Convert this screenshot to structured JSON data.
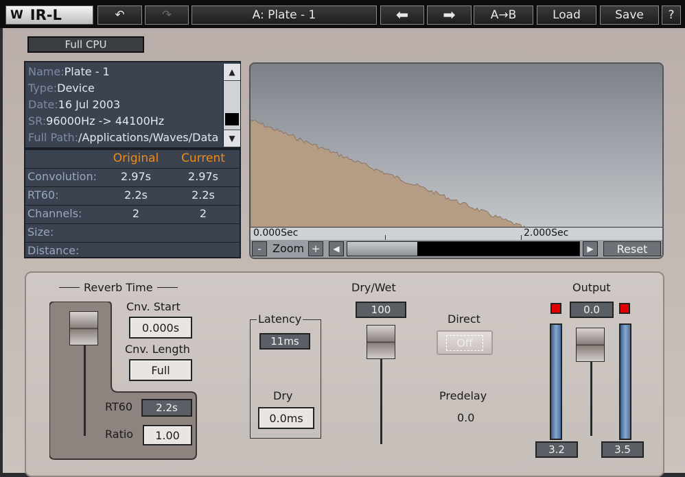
{
  "toolbar": {
    "logo": "IR-L",
    "preset": "A: Plate - 1",
    "ab_label": "A→B",
    "load_label": "Load",
    "save_label": "Save",
    "help_label": "?"
  },
  "cpu_mode": "Full CPU",
  "info": {
    "name_key": "Name:",
    "name": "Plate - 1",
    "type_key": "Type:",
    "type": "Device",
    "date_key": "Date:",
    "date": "16 Jul 2003",
    "sr_key": "SR:",
    "sr": "96000Hz -> 44100Hz",
    "path_key": "Full Path:",
    "path": "/Applications/Waves/Data"
  },
  "params_table": {
    "headers": [
      "Original",
      "Current"
    ],
    "rows": [
      {
        "label": "Convolution:",
        "original": "2.97s",
        "current": "2.97s"
      },
      {
        "label": "RT60:",
        "original": "2.2s",
        "current": "2.2s"
      },
      {
        "label": "Channels:",
        "original": "2",
        "current": "2"
      },
      {
        "label": "Size:",
        "original": "",
        "current": ""
      },
      {
        "label": "Distance:",
        "original": "",
        "current": ""
      }
    ]
  },
  "ir_display": {
    "time_start": "0.000Sec",
    "time_mark": "2.000Sec",
    "zoom_minus": "-",
    "zoom_label": "Zoom",
    "zoom_plus": "+",
    "reset_label": "Reset"
  },
  "reverb_time": {
    "title": "Reverb Time",
    "cnv_start_label": "Cnv. Start",
    "cnv_start": "0.000s",
    "cnv_length_label": "Cnv. Length",
    "cnv_length": "Full",
    "rt60_label": "RT60",
    "rt60": "2.2s",
    "ratio_label": "Ratio",
    "ratio": "1.00"
  },
  "latency": {
    "title": "Latency",
    "value": "11ms",
    "dry_label": "Dry",
    "dry_value": "0.0ms"
  },
  "dry_wet": {
    "label": "Dry/Wet",
    "value": "100"
  },
  "direct": {
    "label": "Direct",
    "state": "Off"
  },
  "predelay": {
    "label": "Predelay",
    "value": "0.0"
  },
  "output": {
    "label": "Output",
    "value": "0.0",
    "meter_left": "3.2",
    "meter_right": "3.5"
  },
  "colors": {
    "accent_header": "#f08a1a",
    "lcd_bg": "#3a434f",
    "clip_red": "#e00000",
    "ir_fill": "#b59c84"
  }
}
